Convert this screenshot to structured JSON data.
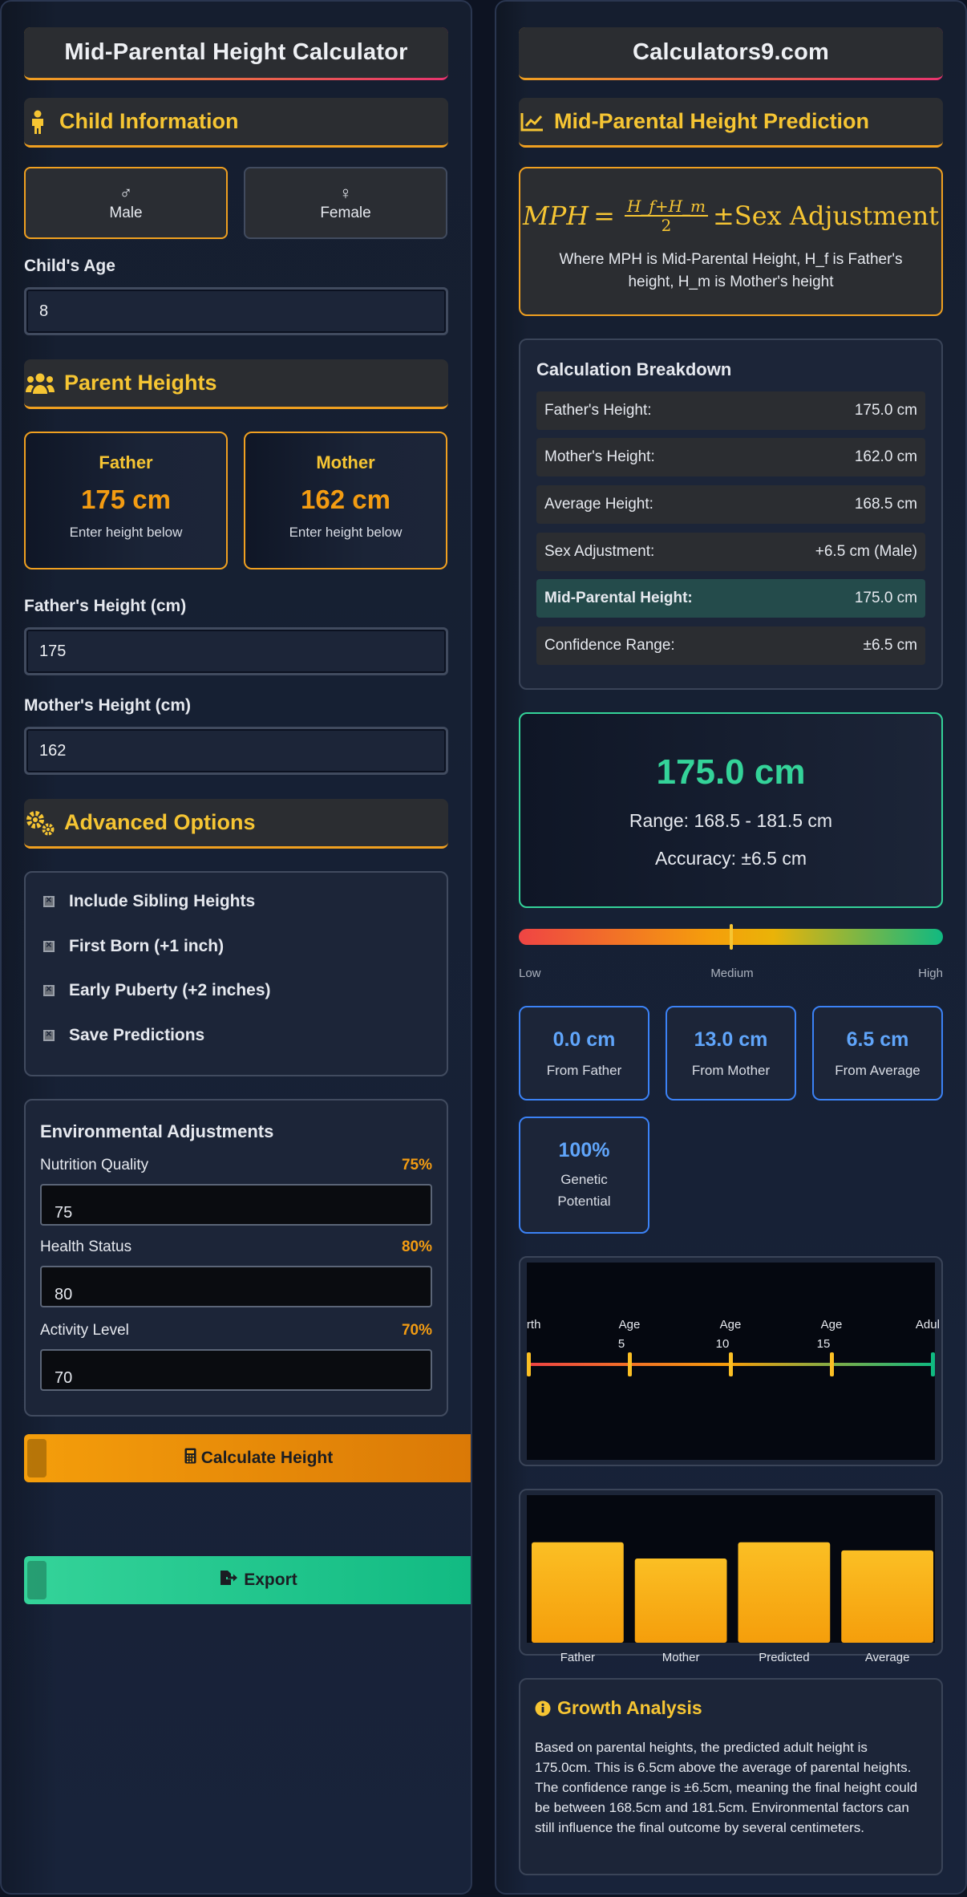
{
  "left": {
    "title": "Mid-Parental Height Calculator",
    "child_section": "Child Information",
    "gender": {
      "male_symbol": "♂",
      "male_label": "Male",
      "female_symbol": "♀",
      "female_label": "Female",
      "selected": "Male"
    },
    "age_label": "Child's Age",
    "age_value": "8",
    "parent_section": "Parent Heights",
    "father_card": {
      "name": "Father",
      "value": "175 cm",
      "hint": "Enter height below"
    },
    "mother_card": {
      "name": "Mother",
      "value": "162 cm",
      "hint": "Enter height below"
    },
    "father_height_label": "Father's Height (cm)",
    "father_height_value": "175",
    "mother_height_label": "Mother's Height (cm)",
    "mother_height_value": "162",
    "advanced_section": "Advanced Options",
    "options": [
      "Include Sibling Heights",
      "First Born (+1 inch)",
      "Early Puberty (+2 inches)",
      "Save Predictions"
    ],
    "env": {
      "title": "Environmental Adjustments",
      "items": [
        {
          "label": "Nutrition Quality",
          "pct": "75%",
          "value": "75"
        },
        {
          "label": "Health Status",
          "pct": "80%",
          "value": "80"
        },
        {
          "label": "Activity Level",
          "pct": "70%",
          "value": "70"
        }
      ]
    },
    "calculate_label": "Calculate Height",
    "export_label": "Export"
  },
  "right": {
    "title": "Calculators9.com",
    "prediction_section": "Mid-Parental Height Prediction",
    "formula": {
      "lhs": "MPH",
      "num": "H_f+H_m",
      "den": "2",
      "rhs": "±Sex Adjustment",
      "description": "Where MPH is Mid-Parental Height, H_f is Father's height, H_m is Mother's height"
    },
    "breakdown": {
      "title": "Calculation Breakdown",
      "rows": [
        {
          "label": "Father's Height:",
          "value": "175.0 cm"
        },
        {
          "label": "Mother's Height:",
          "value": "162.0 cm"
        },
        {
          "label": "Average Height:",
          "value": "168.5 cm"
        },
        {
          "label": "Sex Adjustment:",
          "value": "+6.5 cm (Male)"
        },
        {
          "label": "Mid-Parental Height:",
          "value": "175.0 cm"
        },
        {
          "label": "Confidence Range:",
          "value": "±6.5 cm"
        }
      ]
    },
    "result": {
      "main": "175.0 cm",
      "range": "Range: 168.5 - 181.5 cm",
      "accuracy": "Accuracy: ±6.5 cm"
    },
    "gauge": {
      "low": "Low",
      "medium": "Medium",
      "high": "High",
      "level": 0.5
    },
    "stats": [
      {
        "value": "0.0 cm",
        "label": "From Father"
      },
      {
        "value": "13.0 cm",
        "label": "From Mother"
      },
      {
        "value": "6.5 cm",
        "label": "From Average"
      },
      {
        "value": "100%",
        "label": "Genetic Potential"
      }
    ],
    "timeline": {
      "stages": [
        "Birth",
        "Age 5",
        "Age 10",
        "Age 15",
        "Adult"
      ]
    },
    "analysis": {
      "title": "Growth Analysis",
      "text": "Based on parental heights, the predicted adult height is 175.0cm. This is 6.5cm above the average of parental heights. The confidence range is ±6.5cm, meaning the final height could be between 168.5cm and 181.5cm. Environmental factors can still influence the final outcome by several centimeters."
    }
  },
  "chart_data": {
    "type": "bar",
    "categories": [
      "Father",
      "Mother",
      "Predicted",
      "Average"
    ],
    "values": [
      175,
      162,
      175,
      168.5
    ],
    "ylim": [
      100,
      180
    ],
    "colors": [
      "#f6b51d"
    ],
    "grid": false
  },
  "colors": {
    "accent": "#f6c533",
    "orange": "#f39c12",
    "green": "#34d399",
    "blue": "#60a5fa"
  }
}
